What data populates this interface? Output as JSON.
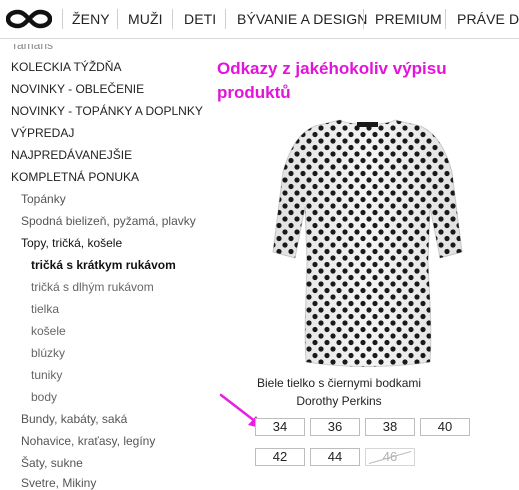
{
  "nav": {
    "items": [
      "ŽENY",
      "MUŽI",
      "DETI",
      "BÝVANIE A DESIGN",
      "PREMIUM",
      "PRÁVE DO"
    ]
  },
  "sidebar": {
    "top_cut": "Tamaris",
    "items": [
      {
        "label": "KOLECKIA TÝŽDŇA"
      },
      {
        "label": "NOVINKY - OBLEČENIE"
      },
      {
        "label": "NOVINKY - TOPÁNKY A DOPLNKY"
      },
      {
        "label": "VÝPREDAJ"
      },
      {
        "label": "NAJPREDÁVANEJŠIE"
      },
      {
        "label": "KOMPLETNÁ PONUKA"
      },
      {
        "label": "Topánky"
      },
      {
        "label": "Spodná bielizeň, pyžamá, plavky"
      },
      {
        "label": "Topy, tričká, košele"
      },
      {
        "label": "tričká s krátkym rukávom"
      },
      {
        "label": "tričká s dlhým rukávom"
      },
      {
        "label": "tielka"
      },
      {
        "label": "košele"
      },
      {
        "label": "blúzky"
      },
      {
        "label": "tuniky"
      },
      {
        "label": "body"
      },
      {
        "label": "Bundy, kabáty, saká"
      },
      {
        "label": "Nohavice, kraťasy, legíny"
      },
      {
        "label": "Šaty, sukne"
      },
      {
        "label": "Svetre, Mikiny"
      }
    ]
  },
  "annotation": {
    "text": "Odkazy z jakéhokoliv výpisu produktů",
    "color": "#e413d9"
  },
  "product": {
    "title": "Biele tielko s čiernymi bodkami Dorothy Perkins",
    "sizes": [
      {
        "label": "34",
        "available": true
      },
      {
        "label": "36",
        "available": true
      },
      {
        "label": "38",
        "available": true
      },
      {
        "label": "40",
        "available": true
      },
      {
        "label": "42",
        "available": true
      },
      {
        "label": "44",
        "available": true
      },
      {
        "label": "46",
        "available": false
      }
    ]
  }
}
